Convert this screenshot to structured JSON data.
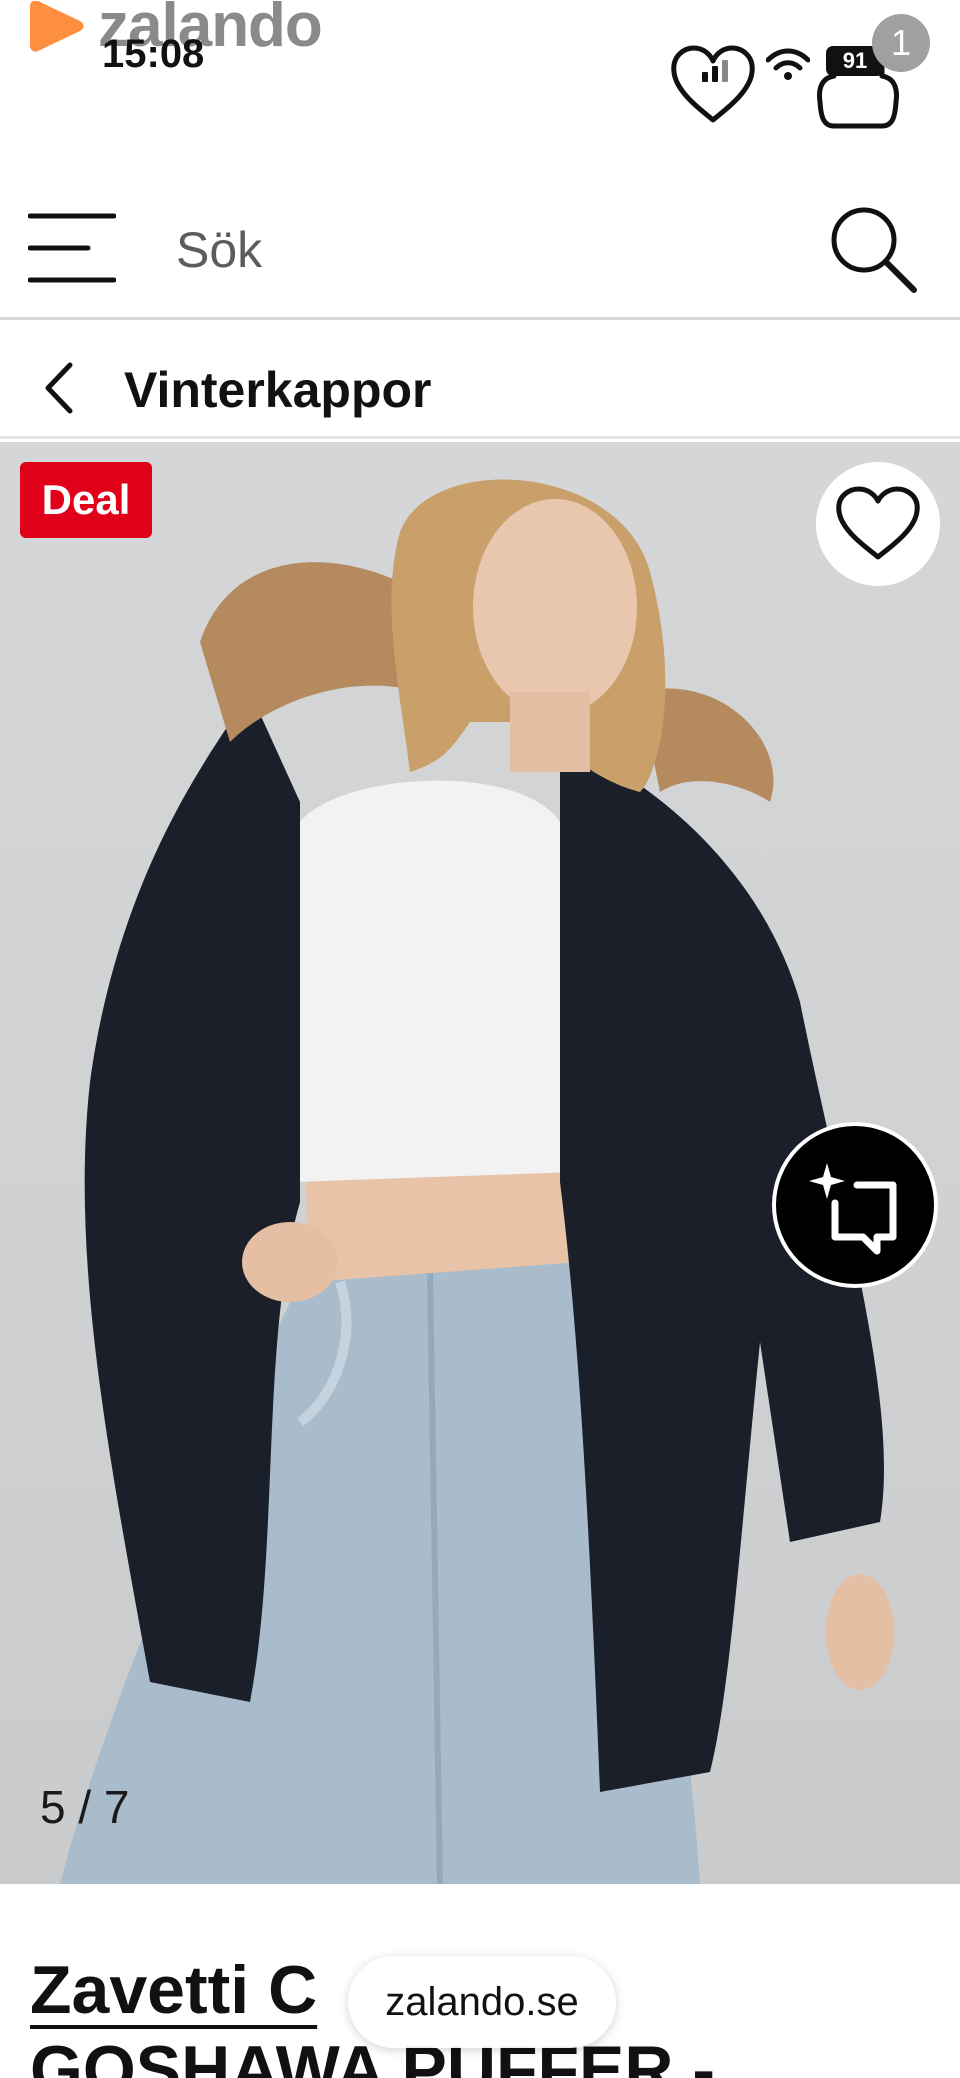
{
  "app": {
    "logo_text": "zalando",
    "brand_color": "#ff6900"
  },
  "status_bar": {
    "time": "15:08",
    "battery": "91",
    "icons": [
      "signal-icon",
      "wifi-icon",
      "battery-icon"
    ]
  },
  "header": {
    "wishlist_icon": "heart-icon",
    "bag_icon": "bag-icon",
    "bag_count": "1"
  },
  "search": {
    "placeholder": "Sök",
    "menu_icon": "hamburger-menu-icon",
    "search_icon": "search-icon"
  },
  "category": {
    "back_icon": "chevron-left-icon",
    "title": "Vinterkappor"
  },
  "product_image": {
    "badge": "Deal",
    "badge_color": "#e1001a",
    "favorite_icon": "heart-icon",
    "assistant_icon": "sparkle-chat-icon",
    "counter": "5 / 7"
  },
  "product": {
    "brand": "Zavetti C",
    "name": "GOSHAWA PUFFER -"
  },
  "browser": {
    "url": "zalando.se"
  }
}
